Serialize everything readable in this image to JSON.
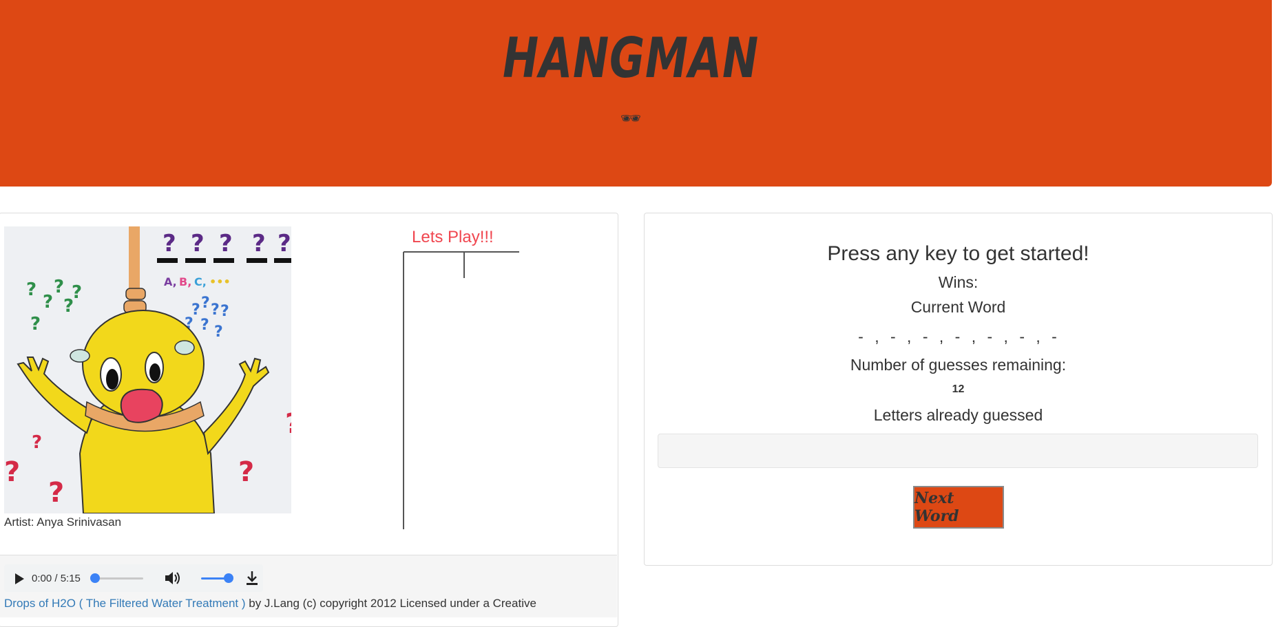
{
  "header": {
    "title": "HANGMAN",
    "subtitle_icon": "sunglasses-icon",
    "subtitle_glyph": "🕶"
  },
  "left_panel": {
    "artwork_icon": "hangman-cartoon-drawing",
    "artist_caption": "Artist: Anya Srinivasan",
    "lets_play": "Lets Play!!!"
  },
  "audio": {
    "time": "0:00 / 5:15",
    "progress": 0.0,
    "volume": 1.0
  },
  "credit": {
    "link_text": "Drops of H2O ( The Filtered Water Treatment )",
    "rest_text": " by J.Lang (c) copyright 2012 Licensed under a Creative"
  },
  "game": {
    "headline": "Press any key to get started!",
    "wins_label": "Wins:",
    "current_word_label": "Current Word",
    "current_word": "- , - , - , - , - , - , -",
    "guesses_label": "Number of guesses remaining:",
    "guesses_value": "12",
    "letters_label": "Letters already guessed",
    "letters_value": "",
    "next_button": "Next Word"
  },
  "colors": {
    "brand": "#dd4814",
    "text": "#333333",
    "accent_red": "#f0464f",
    "link": "#337ab7"
  }
}
